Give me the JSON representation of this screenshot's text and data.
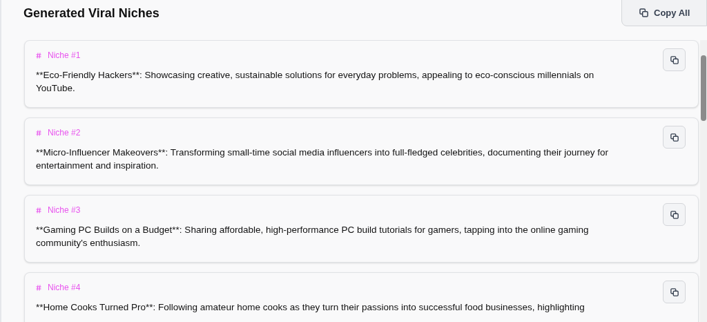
{
  "title": "Generated Viral Niches",
  "copy_all_button": {
    "label": "Copy All"
  },
  "niches": [
    {
      "label": "Niche #1",
      "text": "**Eco-Friendly Hackers**: Showcasing creative, sustainable solutions for everyday problems, appealing to eco-conscious millennials on YouTube."
    },
    {
      "label": "Niche #2",
      "text": "**Micro-Influencer Makeovers**: Transforming small-time social media influencers into full-fledged celebrities, documenting their journey for entertainment and inspiration."
    },
    {
      "label": "Niche #3",
      "text": "**Gaming PC Builds on a Budget**: Sharing affordable, high-performance PC build tutorials for gamers, tapping into the online gaming community's enthusiasm."
    },
    {
      "label": "Niche #4",
      "text": "**Home Cooks Turned Pro**: Following amateur home cooks as they turn their passions into successful food businesses, highlighting"
    }
  ]
}
